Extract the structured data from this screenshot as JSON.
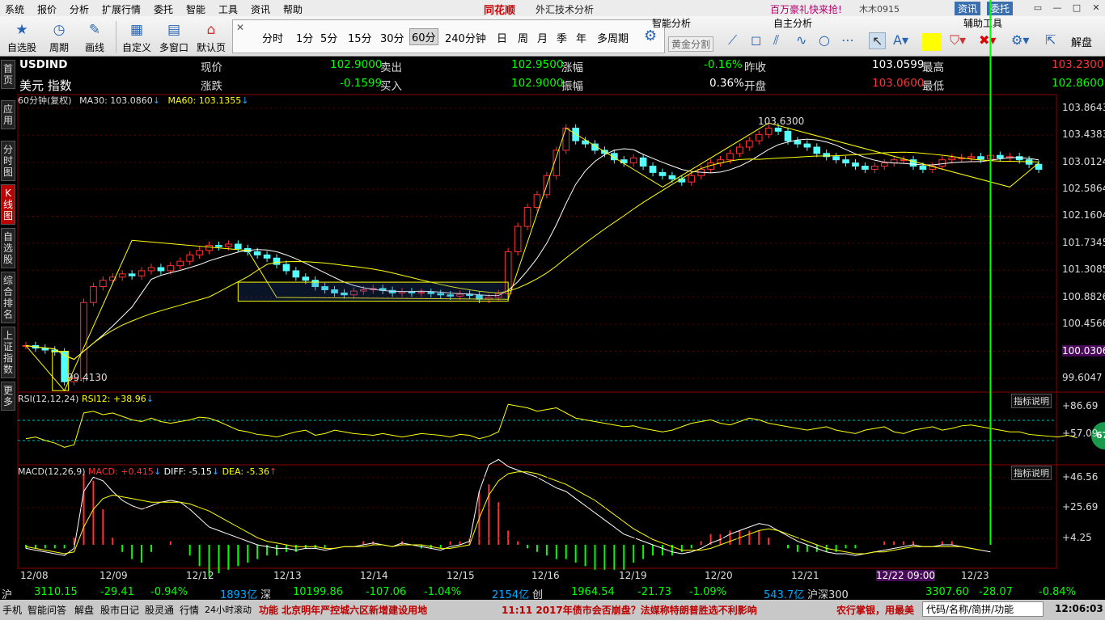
{
  "menu": [
    "系统",
    "报价",
    "分析",
    "扩展行情",
    "委托",
    "智能",
    "工具",
    "资讯",
    "帮助"
  ],
  "brand": "同花顺",
  "app_title": "外汇技术分析",
  "promo": "百万豪礼快来抢!",
  "user": "木木0915",
  "header_btns": {
    "info": "资讯",
    "trade": "委托"
  },
  "toolbar": {
    "items": [
      {
        "label": "自选股",
        "icon": "star-icon"
      },
      {
        "label": "周期",
        "icon": "clock-icon"
      },
      {
        "label": "画线",
        "icon": "pen-icon"
      },
      {
        "label": "自定义",
        "icon": "grid-icon"
      },
      {
        "label": "多窗口",
        "icon": "windows-icon"
      },
      {
        "label": "默认页",
        "icon": "home-icon"
      }
    ],
    "periods": [
      "分时",
      "1分",
      "5分",
      "15分",
      "30分",
      "60分",
      "240分钟",
      "日",
      "周",
      "月",
      "季",
      "年",
      "多周期"
    ],
    "active_period": "60分",
    "panel_tabs": {
      "smart": "智能分析",
      "self": "自主分析",
      "aux": "辅助工具"
    },
    "gold_split": "黄金分割",
    "aux_label": "解盘"
  },
  "sidetabs": [
    "首页",
    "应用",
    "分时图",
    "K线图",
    "自选股",
    "综合排名",
    "上证指数",
    "更多"
  ],
  "quote": {
    "code": "USDIND",
    "name": "美元 指数",
    "row1": {
      "now_label": "现价",
      "now": "102.9000",
      "sell_label": "卖出",
      "sell": "102.9500",
      "chg_label": "涨幅",
      "chg": "-0.16%",
      "prev_label": "昨收",
      "prev": "103.0599",
      "high_label": "最高",
      "high": "103.2300"
    },
    "row2": {
      "delta_label": "涨跌",
      "delta": "-0.1599",
      "buy_label": "买入",
      "buy": "102.9000",
      "amp_label": "振幅",
      "amp": "0.36%",
      "open_label": "开盘",
      "open": "103.0600",
      "low_label": "最低",
      "low": "102.8600"
    }
  },
  "legend": {
    "period": "60分钟(复权)",
    "ma30": "MA30: 103.0860",
    "ma60": "MA60: 103.1355"
  },
  "rsi_legend": {
    "name": "RSI(12,12,24)",
    "val": "RSI12: +38.96"
  },
  "macd_legend": {
    "name": "MACD(12,26,9)",
    "macd": "MACD: +0.415",
    "diff": "DIFF: -5.15",
    "dea": "DEA: -5.36"
  },
  "indicator_help": "指标说明",
  "badge": "67",
  "axis": {
    "price": [
      "103.8643",
      "103.4383",
      "103.0124",
      "102.5864",
      "102.1604",
      "101.7345",
      "101.3085",
      "100.8826",
      "100.4566",
      "100.0306",
      "99.6047"
    ],
    "rsi": [
      "+86.69",
      "+57.09"
    ],
    "macd": [
      "+46.56",
      "+25.69",
      "+4.25"
    ],
    "dates": [
      "12/08",
      "12/09",
      "12/12",
      "12/13",
      "12/14",
      "12/15",
      "12/16",
      "12/19",
      "12/20",
      "12/21",
      "12/22 09:00",
      "12/23"
    ]
  },
  "annotations": {
    "peak": "103.6300",
    "trough": "99.4130"
  },
  "chart_data": {
    "type": "candlestick",
    "title": "USDIND 60分钟",
    "ylim": [
      99.4,
      103.9
    ],
    "close": [
      100.12,
      100.08,
      100.05,
      100.02,
      99.55,
      99.6,
      100.8,
      101.05,
      101.15,
      101.2,
      101.25,
      101.22,
      101.3,
      101.35,
      101.3,
      101.38,
      101.45,
      101.55,
      101.62,
      101.7,
      101.68,
      101.72,
      101.65,
      101.6,
      101.55,
      101.5,
      101.4,
      101.3,
      101.2,
      101.15,
      101.05,
      101.0,
      100.95,
      100.92,
      100.98,
      101.0,
      101.02,
      100.99,
      100.95,
      100.97,
      100.95,
      100.96,
      100.94,
      100.92,
      100.9,
      100.93,
      100.91,
      100.85,
      100.88,
      100.94,
      101.6,
      102.0,
      102.3,
      102.5,
      102.8,
      103.2,
      103.55,
      103.35,
      103.3,
      103.2,
      103.15,
      103.05,
      103.0,
      103.08,
      102.95,
      102.85,
      102.8,
      102.75,
      102.7,
      102.8,
      102.9,
      103.0,
      103.05,
      103.15,
      103.25,
      103.35,
      103.45,
      103.55,
      103.5,
      103.35,
      103.3,
      103.25,
      103.15,
      103.1,
      103.05,
      103.0,
      102.95,
      102.9,
      102.95,
      103.0,
      103.05,
      103.05,
      102.95,
      102.9,
      102.95,
      103.05,
      103.08,
      103.08,
      103.1,
      103.06,
      103.12,
      103.08,
      103.1,
      103.05,
      102.98,
      102.9
    ],
    "rsi": [
      40,
      42,
      38,
      35,
      30,
      33,
      70,
      72,
      68,
      70,
      66,
      62,
      60,
      64,
      60,
      58,
      60,
      62,
      65,
      64,
      60,
      55,
      50,
      48,
      45,
      44,
      42,
      45,
      48,
      50,
      44,
      46,
      50,
      48,
      46,
      45,
      44,
      46,
      44,
      42,
      44,
      46,
      45,
      44,
      42,
      45,
      44,
      40,
      43,
      48,
      80,
      78,
      76,
      72,
      74,
      76,
      70,
      64,
      62,
      60,
      58,
      56,
      54,
      55,
      52,
      50,
      48,
      50,
      54,
      58,
      60,
      62,
      58,
      56,
      60,
      64,
      62,
      58,
      56,
      54,
      52,
      50,
      52,
      54,
      50,
      48,
      46,
      50,
      52,
      54,
      48,
      46,
      50,
      52,
      54,
      50,
      52,
      55,
      56,
      54,
      52,
      50,
      48,
      48,
      45,
      44,
      43,
      42,
      44,
      41
    ],
    "macd_diff": [
      -2,
      -3,
      -4,
      -5,
      -6,
      -2,
      30,
      38,
      36,
      30,
      25,
      22,
      20,
      22,
      24,
      25,
      24,
      20,
      15,
      10,
      8,
      6,
      4,
      2,
      0,
      -1,
      -2,
      -2,
      -3,
      -2,
      -2,
      -3,
      -2,
      -1,
      -1,
      0,
      1,
      0,
      -1,
      1,
      0,
      -1,
      -2,
      -3,
      -1,
      0,
      2,
      30,
      45,
      48,
      44,
      42,
      40,
      38,
      35,
      32,
      30,
      26,
      22,
      18,
      14,
      10,
      6,
      4,
      2,
      0,
      -2,
      -4,
      -5,
      -4,
      -2,
      1,
      3,
      6,
      8,
      10,
      12,
      11,
      8,
      5,
      2,
      0,
      -2,
      -4,
      -5,
      -5,
      -6,
      -5,
      -4,
      -3,
      -2,
      -1,
      0,
      -1,
      -1,
      0,
      0,
      -1,
      -2,
      -3,
      -4
    ],
    "macd_dea": [
      -1,
      -2,
      -3,
      -4,
      -5,
      -4,
      10,
      20,
      26,
      28,
      27,
      26,
      25,
      24,
      24,
      24,
      24,
      23,
      21,
      19,
      16,
      13,
      10,
      7,
      4,
      2,
      1,
      0,
      -1,
      -1,
      -1,
      -2,
      -2,
      -1,
      -1,
      -1,
      0,
      0,
      -1,
      0,
      0,
      0,
      -1,
      -2,
      -2,
      -1,
      0,
      15,
      28,
      36,
      40,
      41,
      41,
      40,
      38,
      36,
      34,
      31,
      28,
      25,
      21,
      17,
      13,
      9,
      6,
      3,
      1,
      -1,
      -3,
      -3,
      -3,
      -2,
      0,
      2,
      4,
      6,
      8,
      9,
      8,
      6,
      4,
      2,
      0,
      -2,
      -3,
      -4,
      -5,
      -5,
      -4,
      -4,
      -3,
      -2,
      -1,
      -1,
      -1,
      -1,
      -1,
      -1,
      -2,
      -3
    ]
  },
  "bottom": {
    "sh_label": "沪",
    "sh": "3110.15",
    "sh_chg": "-29.41",
    "sh_pct": "-0.94%",
    "sh_amt": "1893亿",
    "sz_label": "深",
    "sz": "10199.86",
    "sz_chg": "-107.06",
    "sz_pct": "-1.04%",
    "sz_amt": "2154亿",
    "cy_label": "创",
    "cy": "1964.54",
    "cy_chg": "-21.73",
    "cy_pct": "-1.09%",
    "cy_amt": "543.7亿",
    "hs_label": "沪深300",
    "hs": "3307.60",
    "hs_chg": "-28.07",
    "hs_pct": "-0.84%"
  },
  "status": {
    "items": [
      "手机",
      "智能问答",
      "解盘",
      "股市日记",
      "股灵通",
      "行情",
      "24小时滚动"
    ],
    "news1": "功能 北京明年严控城六区新增建设用地",
    "news2": "11:11 2017年债市会否崩盘？法媒称特朗普胜选不利影响",
    "news3": "农行掌银，用最美",
    "search": "代码/名称/简拼/功能",
    "time": "12:06:03"
  }
}
